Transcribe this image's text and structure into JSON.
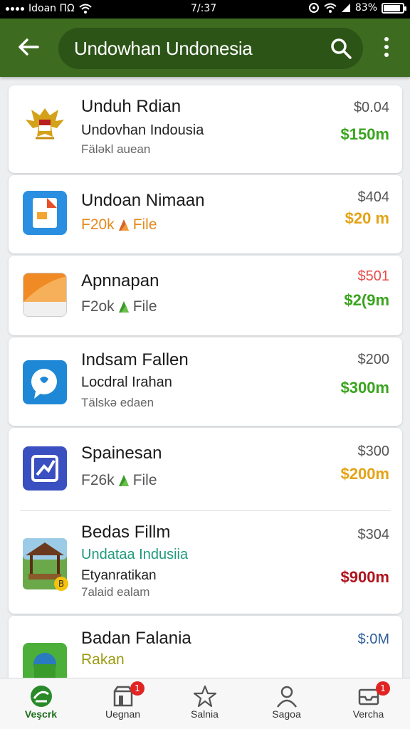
{
  "status_bar": {
    "carrier": "Idoan ΠΩ",
    "time": "7/:37",
    "battery": "83%",
    "battery_level": 0.83
  },
  "app_bar": {
    "search_text": "Undowhan Undonesia"
  },
  "items": [
    {
      "title": "Unduh Rdian",
      "subtitle": "Undovhan Indousia",
      "meta": "Fäləkl auean",
      "price_old": "$0.04",
      "price_new": "$150m",
      "price_color": "#3aa41f"
    },
    {
      "title": "Undoan Nimaan",
      "file": "F20k",
      "file_label": "File",
      "price_old": "$404",
      "price_new": "$20 m",
      "price_color": "#e4a316"
    },
    {
      "title": "Apnnapan",
      "file": "F2ok",
      "file_label": "File",
      "price_old": "$501",
      "price_new": "$2(9m",
      "price_color": "#3aa41f",
      "price_old_color": "#e84b4b"
    },
    {
      "title": "Indsam Fallen",
      "subtitle": "Locdral Irahan",
      "meta": "Tälskə edaen",
      "price_old": "$200",
      "price_new": "$300m",
      "price_color": "#3aa41f"
    },
    {
      "title": "Spainesan",
      "file": "F26k",
      "file_label": "File",
      "price_old": "$300",
      "price_new": "$200m",
      "price_color": "#e4a316"
    },
    {
      "title": "Bedas Fillm",
      "subtitle": "Undataa Indusiia",
      "subtitle_color": "#1e9a7a",
      "subtitle2": "Etyanratikan",
      "meta": "7alaid ealam",
      "price_old": "$304",
      "price_new": "$900m",
      "price_color": "#b0141e",
      "badge": "B"
    },
    {
      "title": "Badan Falania",
      "subtitle": "Rakan",
      "subtitle_color": "#9a9a10",
      "price_old": "$:0M",
      "price_old_color": "#2f5f9a"
    }
  ],
  "bottom_nav": [
    {
      "label": "Veşcrk",
      "icon": "home-globe-icon",
      "active": true
    },
    {
      "label": "Uegnan",
      "icon": "store-icon",
      "badge": "1"
    },
    {
      "label": "Salnia",
      "icon": "star-icon"
    },
    {
      "label": "Sagoa",
      "icon": "user-icon"
    },
    {
      "label": "Vercha",
      "icon": "inbox-icon",
      "badge": "1"
    }
  ],
  "colors": {
    "app_bar": "#3d6b1f",
    "search_pill": "#2c5417",
    "green_price": "#3aa41f",
    "orange_price": "#e4a316",
    "red_price": "#b0141e"
  }
}
